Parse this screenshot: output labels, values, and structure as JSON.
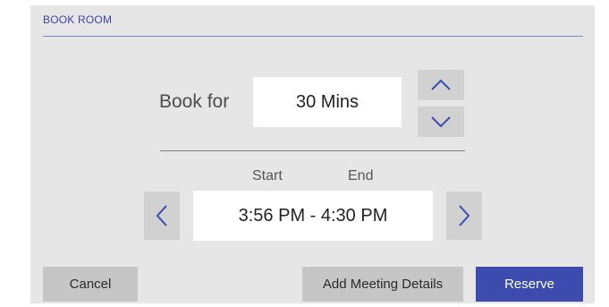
{
  "dialog": {
    "title": "BOOK ROOM"
  },
  "duration": {
    "label": "Book for",
    "value": "30 Mins",
    "increase_icon": "chevron-up-icon",
    "decrease_icon": "chevron-down-icon"
  },
  "time_range": {
    "start_label": "Start",
    "end_label": "End",
    "value": "3:56 PM - 4:30 PM",
    "prev_icon": "chevron-left-icon",
    "next_icon": "chevron-right-icon"
  },
  "actions": {
    "cancel_label": "Cancel",
    "details_label": "Add Meeting Details",
    "reserve_label": "Reserve"
  },
  "colors": {
    "accent": "#3b4cae",
    "panel_background": "#e6e6e6",
    "button_gray": "#c6c6c6"
  }
}
